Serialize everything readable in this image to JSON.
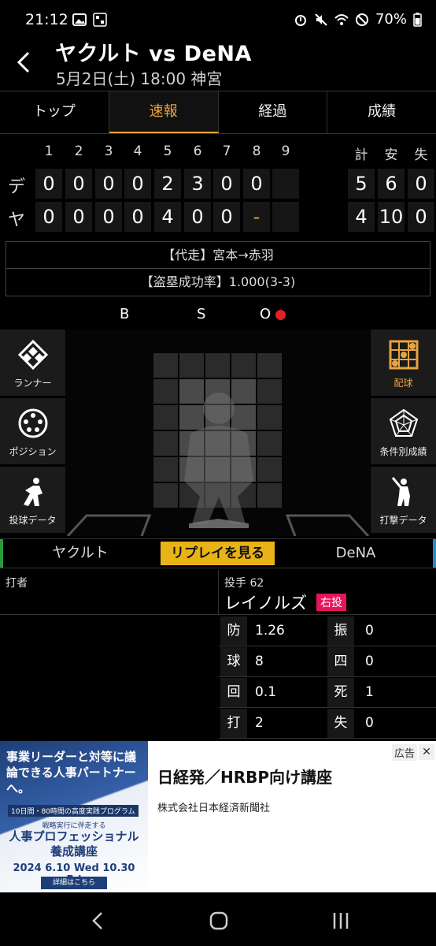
{
  "status_bar": {
    "time": "21:12",
    "battery": "70%",
    "icons_left": [
      "gallery-icon",
      "qr-icon"
    ],
    "icons_right": [
      "alarm-icon",
      "mute-icon",
      "wifi-icon",
      "no-disturb-icon",
      "battery-icon"
    ]
  },
  "header": {
    "title": "ヤクルト vs DeNA",
    "subtitle": "5月2日(土) 18:00 神宮"
  },
  "tabs": [
    {
      "label": "トップ",
      "active": false
    },
    {
      "label": "速報",
      "active": true
    },
    {
      "label": "経過",
      "active": false
    },
    {
      "label": "成績",
      "active": false
    }
  ],
  "scoreboard": {
    "innings": [
      "1",
      "2",
      "3",
      "4",
      "5",
      "6",
      "7",
      "8",
      "9"
    ],
    "totals_headers": [
      "計",
      "安",
      "失"
    ],
    "teams": [
      {
        "abbr": "デ",
        "runs": [
          "0",
          "0",
          "0",
          "0",
          "2",
          "3",
          "0",
          "0",
          ""
        ],
        "totals": [
          "5",
          "6",
          "0"
        ]
      },
      {
        "abbr": "ヤ",
        "runs": [
          "0",
          "0",
          "0",
          "0",
          "4",
          "0",
          "0",
          "-",
          ""
        ],
        "totals": [
          "4",
          "10",
          "0"
        ]
      }
    ]
  },
  "info": {
    "line1": "【代走】宮本→赤羽",
    "line2": "【盗塁成功率】1.000(3-3)"
  },
  "count": {
    "b_label": "B",
    "s_label": "S",
    "o_label": "O",
    "outs": 1,
    "out_color": "#e0202a"
  },
  "side_left": [
    {
      "label": "ランナー",
      "icon": "diamond-icon"
    },
    {
      "label": "ポジション",
      "icon": "positions-icon"
    },
    {
      "label": "投球データ",
      "icon": "pitcher-icon"
    }
  ],
  "side_right": [
    {
      "label": "配球",
      "icon": "grid-pitch-icon",
      "active": true
    },
    {
      "label": "条件別成績",
      "icon": "radar-icon"
    },
    {
      "label": "打撃データ",
      "icon": "batter-icon"
    }
  ],
  "team_selector": {
    "left": "ヤクルト",
    "replay": "リプレイを見る",
    "right": "DeNA",
    "left_color": "#2a9a3c",
    "right_color": "#2a8ac8"
  },
  "batter": {
    "label": "打者"
  },
  "pitcher": {
    "label": "投手 62",
    "name": "レイノルズ",
    "hand": "右投",
    "hand_color": "#e4155b"
  },
  "pitcher_stats": [
    {
      "k1": "防",
      "v1": "1.26",
      "k2": "振",
      "v2": "0"
    },
    {
      "k1": "球",
      "v1": "8",
      "k2": "四",
      "v2": "0"
    },
    {
      "k1": "回",
      "v1": "0.1",
      "k2": "死",
      "v2": "1"
    },
    {
      "k1": "打",
      "v1": "2",
      "k2": "失",
      "v2": "0"
    }
  ],
  "ad": {
    "badge": "広告",
    "img_line1": "事業リーダーと対等に議論できる人事パートナーへ。",
    "img_line2": "10日間・80時間の高度実践プログラム",
    "img_line3": "戦略実行に伴走する",
    "img_line4": "人事プロフェッショナル養成講座",
    "img_line5": "2024 6.10 Wed 10.30 Fri",
    "img_button": "詳細はこちら",
    "headline": "日経発／HRBP向け講座",
    "company": "株式会社日本経済新聞社"
  },
  "nav": [
    "back-nav-icon",
    "home-nav-icon",
    "recents-nav-icon"
  ]
}
